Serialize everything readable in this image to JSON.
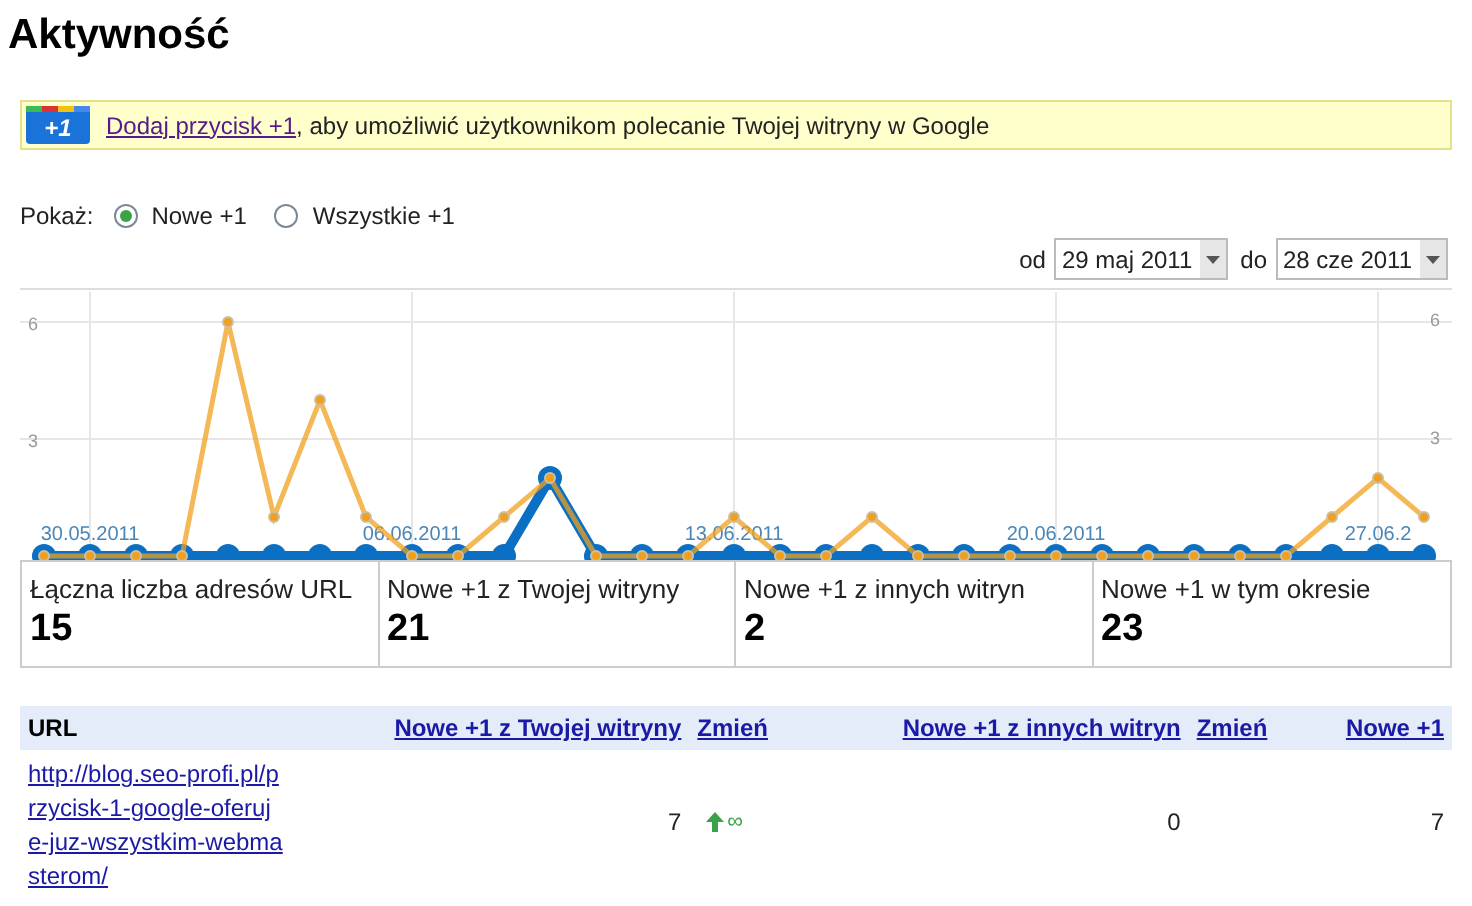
{
  "title": "Aktywność",
  "banner": {
    "badge": "+1",
    "link": "Dodaj przycisk +1",
    "text": ", aby umożliwić użytkownikom polecanie Twojej witryny w Google"
  },
  "show": {
    "label": "Pokaż:",
    "options": [
      {
        "label": "Nowe +1",
        "selected": true
      },
      {
        "label": "Wszystkie +1",
        "selected": false
      }
    ]
  },
  "date_range": {
    "from_label": "od",
    "from": "29 maj 2011",
    "to_label": "do",
    "to": "28 cze 2011"
  },
  "chart": {
    "chart_data": {
      "type": "line",
      "categories": [
        null,
        "30.05.2011",
        null,
        null,
        null,
        null,
        null,
        null,
        "06.06.2011",
        null,
        null,
        null,
        null,
        null,
        null,
        "13.06.2011",
        null,
        null,
        null,
        null,
        null,
        null,
        "20.06.2011",
        null,
        null,
        null,
        null,
        null,
        null,
        "27.06.2",
        null
      ],
      "series": [
        {
          "color": "#f0a01e",
          "marker": "circle",
          "values": [
            0,
            0,
            0,
            0,
            6,
            1,
            4,
            1,
            0,
            0,
            1,
            2,
            0,
            0,
            0,
            1,
            0,
            0,
            1,
            0,
            0,
            0,
            0,
            0,
            0,
            0,
            0,
            0,
            1,
            2,
            1
          ]
        },
        {
          "color": "#0b6fc4",
          "marker": "circle",
          "values": [
            0,
            0,
            0,
            0,
            0,
            0,
            0,
            0,
            0,
            0,
            0,
            2,
            0,
            0,
            0,
            0,
            0,
            0,
            0,
            0,
            0,
            0,
            0,
            0,
            0,
            0,
            0,
            0,
            0,
            0,
            0
          ]
        }
      ],
      "ylim": [
        0,
        6.77
      ],
      "yticks": [
        3,
        6
      ],
      "grid": true
    },
    "right_axis_labels": [
      "6",
      "3"
    ]
  },
  "stats": [
    {
      "label": "Łączna liczba adresów URL",
      "value": "15"
    },
    {
      "label": "Nowe +1 z Twojej witryny",
      "value": "21"
    },
    {
      "label": "Nowe +1 z innych witryn",
      "value": "2"
    },
    {
      "label": "Nowe +1 w tym okresie",
      "value": "23"
    }
  ],
  "table": {
    "columns": [
      "URL",
      "Nowe +1 z Twojej witryny",
      "Zmień",
      "Nowe +1 z innych witryn",
      "Zmień",
      "Nowe +1"
    ],
    "rows": [
      {
        "url": "http://blog.seo-profi.pl/przycisk-1-google-oferuje-juz-wszystkim-webmasterom/",
        "own": "7",
        "own_change": {
          "kind": "increase",
          "text": "∞"
        },
        "other": "0",
        "total": "7"
      }
    ]
  }
}
